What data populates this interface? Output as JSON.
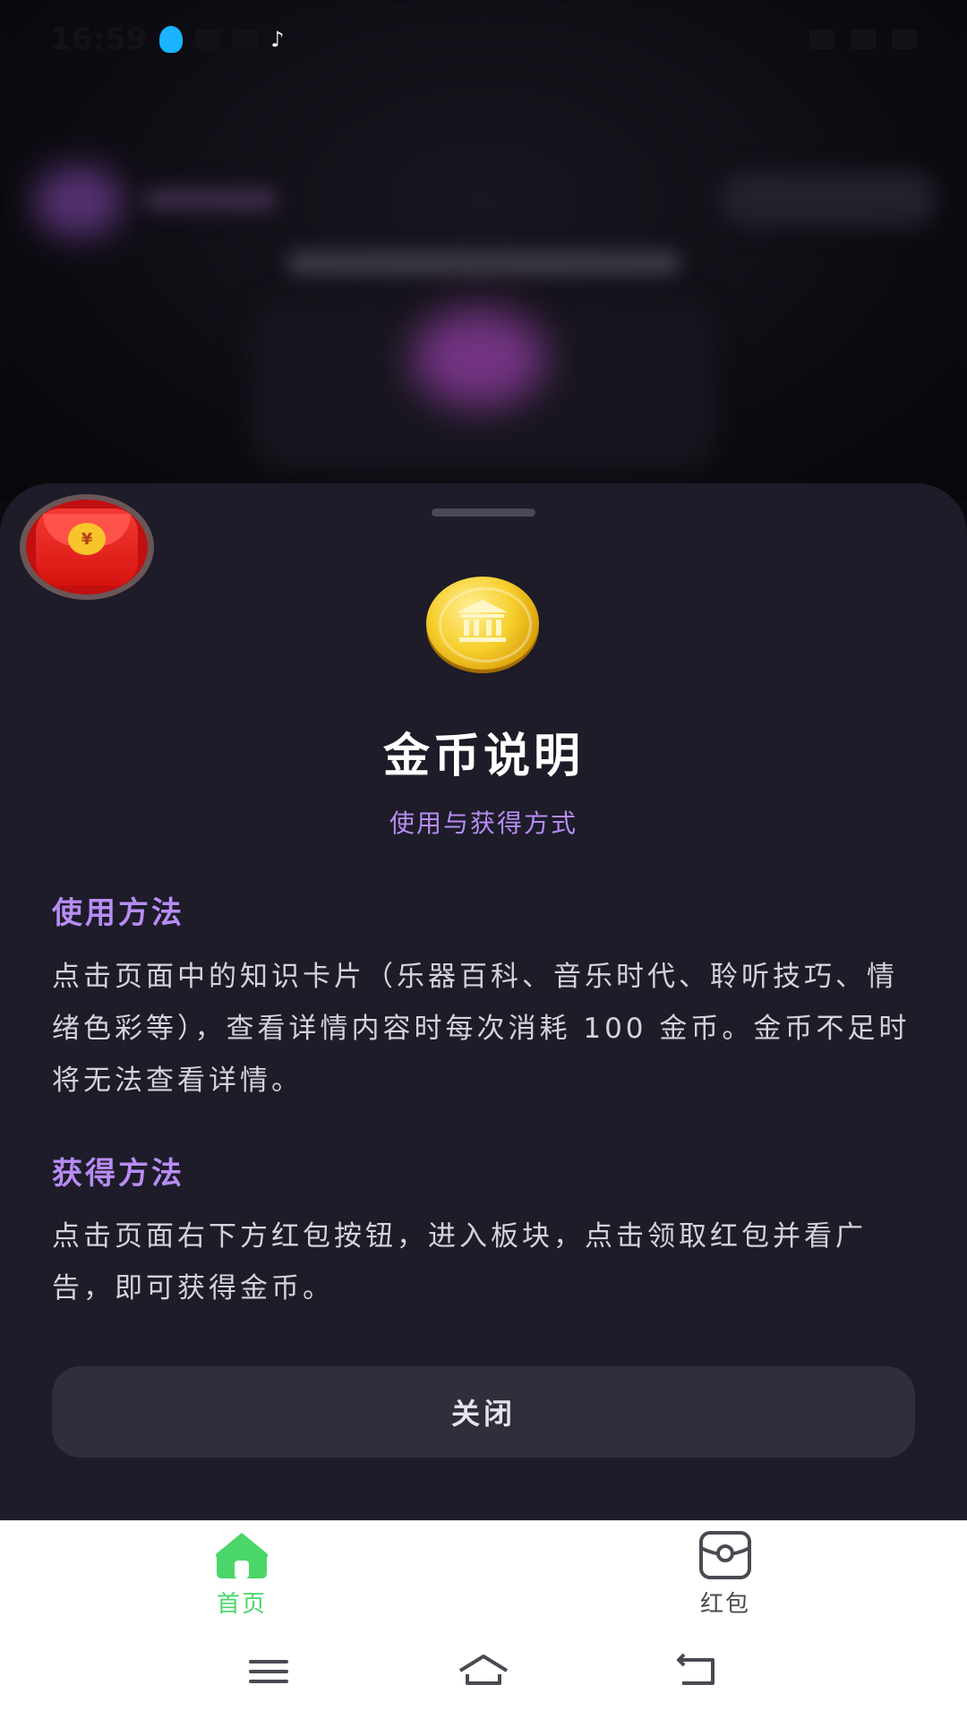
{
  "status_bar": {
    "time": "16:59"
  },
  "sheet": {
    "title": "金币说明",
    "subtitle": "使用与获得方式",
    "sections": [
      {
        "heading": "使用方法",
        "body": "点击页面中的知识卡片（乐器百科、音乐时代、聆听技巧、情绪色彩等），查看详情内容时每次消耗 100 金币。金币不足时将无法查看详情。"
      },
      {
        "heading": "获得方法",
        "body": "点击页面右下方红包按钮，进入板块，点击领取红包并看广告，即可获得金币。"
      }
    ],
    "close_label": "关闭",
    "red_packet_symbol": "¥"
  },
  "tabbar": {
    "items": [
      {
        "label": "首页",
        "icon": "home-icon",
        "active": true
      },
      {
        "label": "红包",
        "icon": "red-packet-icon",
        "active": false
      }
    ],
    "active_color": "#4bd66a",
    "inactive_color": "#4a4a52"
  },
  "colors": {
    "sheet_bg": "#1d1c28",
    "accent_purple": "#b88cf5",
    "button_bg": "#2f2e3a"
  }
}
